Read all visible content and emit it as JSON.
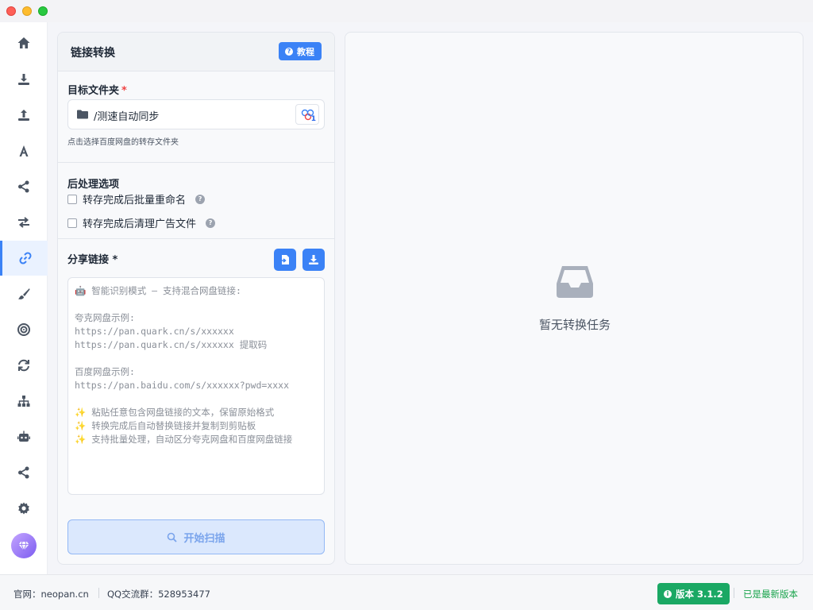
{
  "panel": {
    "title": "链接转换",
    "tutorial_label": "教程"
  },
  "target_folder": {
    "label": "目标文件夹",
    "required_mark": "*",
    "path": "/测速自动同步",
    "picker_count": "1",
    "hint": "点击选择百度网盘的转存文件夹"
  },
  "post_process": {
    "label": "后处理选项",
    "options": [
      {
        "label": "转存完成后批量重命名",
        "checked": false
      },
      {
        "label": "转存完成后清理广告文件",
        "checked": false
      }
    ]
  },
  "share_links": {
    "label": "分享链接 *",
    "placeholder": "🤖 智能识别模式 – 支持混合网盘链接:\n\n夸克网盘示例:\nhttps://pan.quark.cn/s/xxxxxx\nhttps://pan.quark.cn/s/xxxxxx 提取码\n\n百度网盘示例:\nhttps://pan.baidu.com/s/xxxxxx?pwd=xxxx\n\n✨ 粘贴任意包含网盘链接的文本，保留原始格式\n✨ 转换完成后自动替换链接并复制到剪贴板\n✨ 支持批量处理，自动区分夸克网盘和百度网盘链接"
  },
  "scan_button": "开始扫描",
  "empty_state": "暂无转换任务",
  "footer": {
    "site": "官网：neopan.cn",
    "qq": "QQ交流群：528953477",
    "version": "版本 3.1.2",
    "latest": "已是最新版本"
  },
  "colors": {
    "accent": "#3b82f6",
    "success": "#1aa864",
    "required": "#ef4444"
  }
}
